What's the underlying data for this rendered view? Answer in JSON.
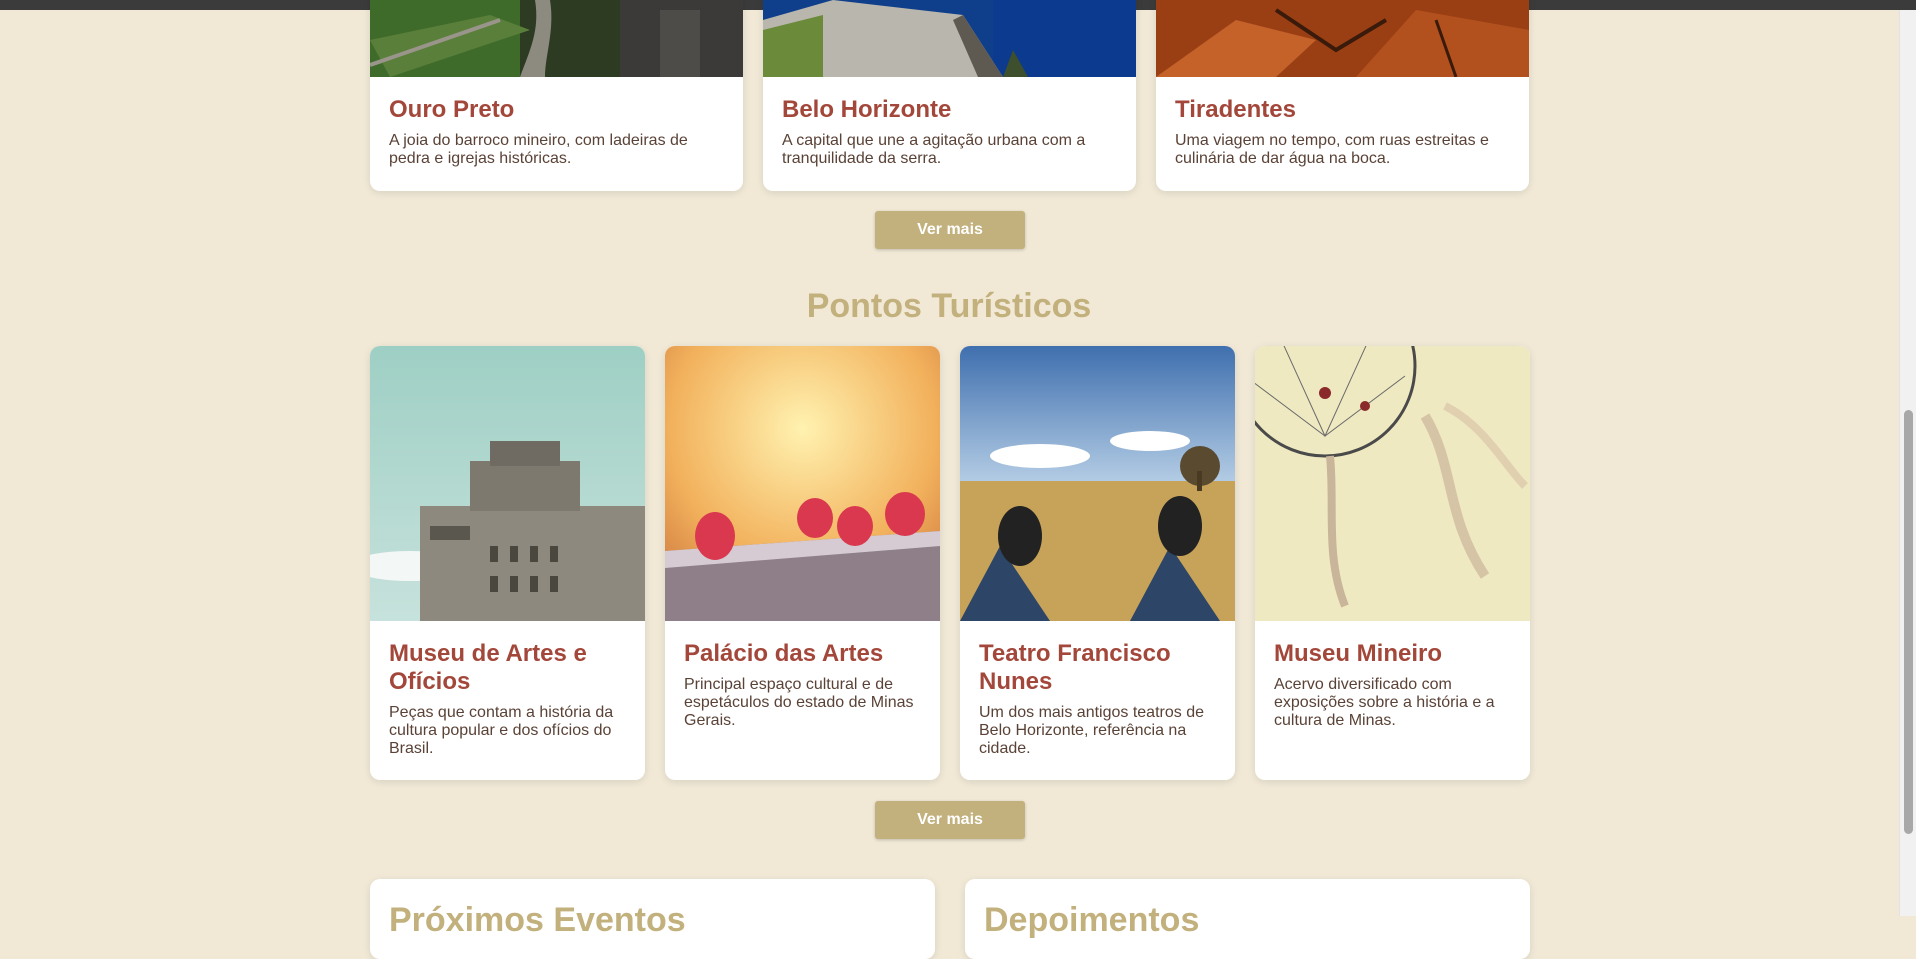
{
  "cities": [
    {
      "title": "Ouro Preto",
      "desc": "A joia do barroco mineiro, com ladeiras de pedra e igrejas históricas."
    },
    {
      "title": "Belo Horizonte",
      "desc": "A capital que une a agitação urbana com a tranquilidade da serra."
    },
    {
      "title": "Tiradentes",
      "desc": "Uma viagem no tempo, com ruas estreitas e culinária de dar água na boca."
    }
  ],
  "buttons": {
    "ver_mais_1": "Ver mais",
    "ver_mais_2": "Ver mais"
  },
  "attractions_section": {
    "title": "Pontos Turísticos"
  },
  "attractions": [
    {
      "title": "Museu de Artes e Ofícios",
      "desc": "Peças que contam a história da cultura popular e dos ofícios do Brasil."
    },
    {
      "title": "Palácio das Artes",
      "desc": "Principal espaço cultural e de espetáculos do estado de Minas Gerais."
    },
    {
      "title": "Teatro Francisco Nunes",
      "desc": "Um dos mais antigos teatros de Belo Horizonte, referência na cidade."
    },
    {
      "title": "Museu Mineiro",
      "desc": "Acervo diversificado com exposições sobre a história e a cultura de Minas."
    }
  ],
  "events_panel": {
    "title": "Próximos Eventos"
  },
  "testimonials_panel": {
    "title": "Depoimentos"
  },
  "colors": {
    "accent": "#c2b07d",
    "card_title": "#a3473a",
    "background": "#f1e9d6"
  }
}
